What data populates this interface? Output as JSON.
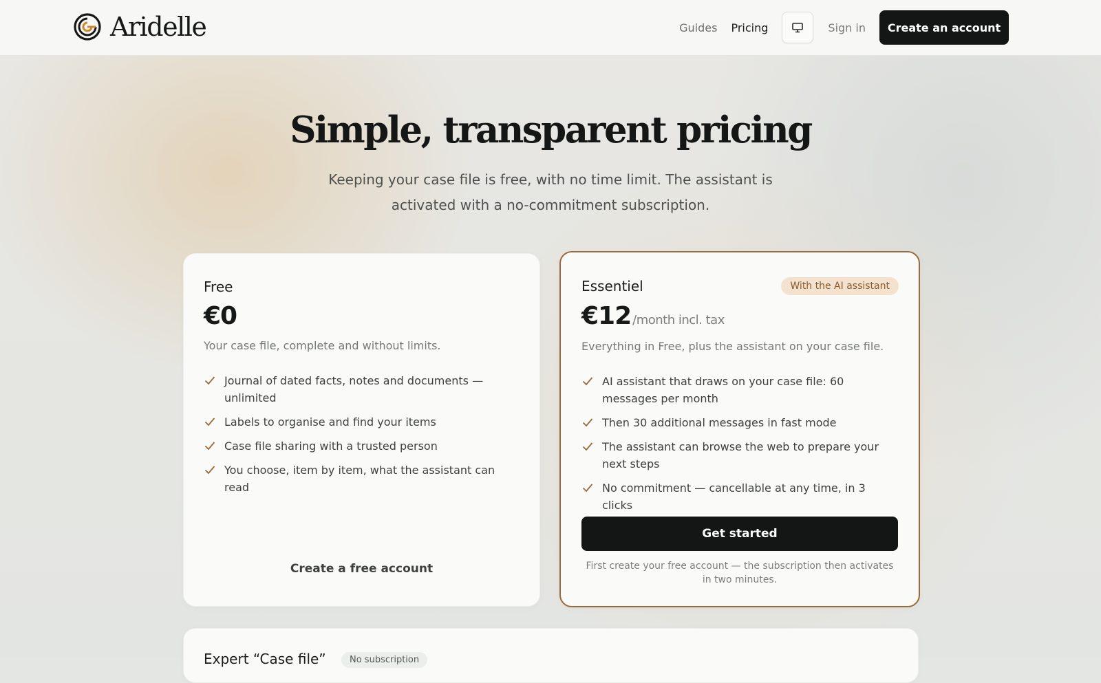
{
  "header": {
    "brand": "Aridelle",
    "nav": [
      {
        "label": "Guides",
        "active": false
      },
      {
        "label": "Pricing",
        "active": true
      }
    ],
    "theme_icon": "monitor-icon",
    "signin_label": "Sign in",
    "create_account_label": "Create an account"
  },
  "hero": {
    "title": "Simple, transparent pricing",
    "subtitle": "Keeping your case file is free, with no time limit. The assistant is activated with a no-commitment subscription."
  },
  "plans": [
    {
      "name": "Free",
      "price": "€0",
      "price_unit": "",
      "description": "Your case file, complete and without limits.",
      "features": [
        "Journal of dated facts, notes and documents — unlimited",
        "Labels to organise and find your items",
        "Case file sharing with a trusted person",
        "You choose, item by item, what the assistant can read"
      ],
      "cta": "Create a free account"
    },
    {
      "name": "Essentiel",
      "badge": "With the AI assistant",
      "price": "€12",
      "price_unit": "/month incl. tax",
      "description": "Everything in Free, plus the assistant on your case file.",
      "features": [
        "AI assistant that draws on your case file: 60 messages per month",
        "Then 30 additional messages in fast mode",
        "The assistant can browse the web to prepare your next steps",
        "No commitment — cancellable at any time, in 3 clicks"
      ],
      "cta": "Get started",
      "footnote": "First create your free account — the subscription then activates in two minutes."
    }
  ],
  "expert": {
    "title": "Expert “Case file”",
    "badge": "No subscription"
  },
  "colors": {
    "accent": "#9a6a3b",
    "dark": "#131615",
    "badge_bg": "#f4e2cf"
  }
}
